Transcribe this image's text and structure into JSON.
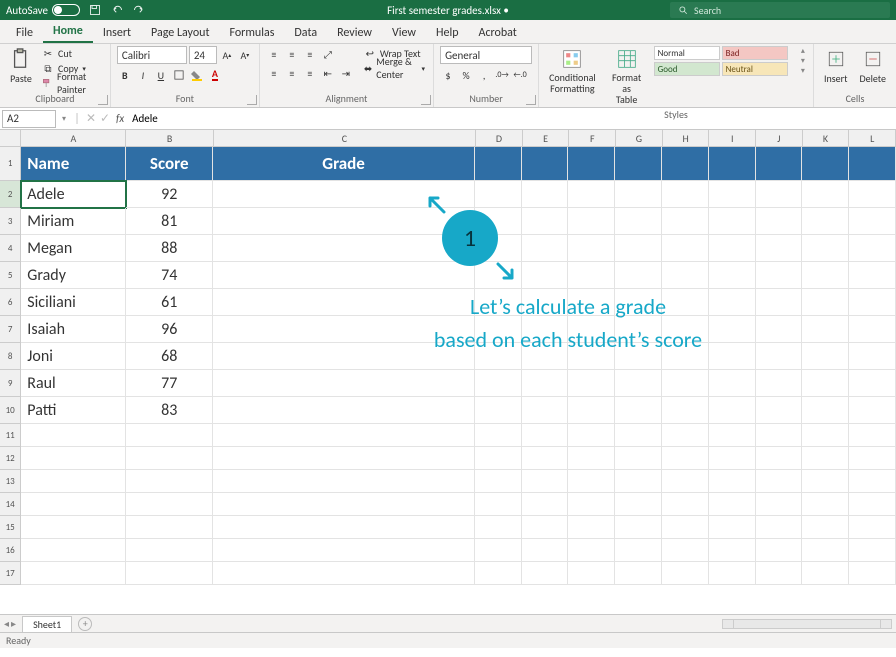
{
  "title": "First semester grades.xlsx •",
  "autosave_label": "AutoSave",
  "autosave_state": "Off",
  "search_placeholder": "Search",
  "menu_tabs": [
    "File",
    "Home",
    "Insert",
    "Page Layout",
    "Formulas",
    "Data",
    "Review",
    "View",
    "Help",
    "Acrobat"
  ],
  "active_menu_tab": "Home",
  "ribbon": {
    "clipboard": {
      "label": "Clipboard",
      "paste": "Paste",
      "cut": "Cut",
      "copy": "Copy",
      "format_painter": "Format Painter"
    },
    "font": {
      "label": "Font",
      "name": "Calibri",
      "size": "24"
    },
    "alignment": {
      "label": "Alignment",
      "wrap": "Wrap Text",
      "merge": "Merge & Center"
    },
    "number": {
      "label": "Number",
      "format": "General"
    },
    "styles": {
      "label": "Styles",
      "conditional": "Conditional\nFormatting",
      "format_table": "Format as\nTable",
      "normal": "Normal",
      "bad": "Bad",
      "good": "Good",
      "neutral": "Neutral"
    },
    "cells": {
      "label": "Cells",
      "insert": "Insert",
      "delete": "Delete"
    }
  },
  "name_box": "A2",
  "formula_value": "Adele",
  "columns": [
    "A",
    "B",
    "C",
    "D",
    "E",
    "F",
    "G",
    "H",
    "I",
    "J",
    "K",
    "L"
  ],
  "chart_data": {
    "type": "table",
    "headers": {
      "name": "Name",
      "score": "Score",
      "grade": "Grade"
    },
    "rows": [
      {
        "name": "Adele",
        "score": 92
      },
      {
        "name": "Miriam",
        "score": 81
      },
      {
        "name": "Megan",
        "score": 88
      },
      {
        "name": "Grady",
        "score": 74
      },
      {
        "name": "Siciliani",
        "score": 61
      },
      {
        "name": "Isaiah",
        "score": 96
      },
      {
        "name": "Joni",
        "score": 68
      },
      {
        "name": "Raul",
        "score": 77
      },
      {
        "name": "Patti",
        "score": 83
      }
    ]
  },
  "annotation": {
    "step": "1",
    "line1": "Let’s calculate a grade",
    "line2": "based on each student’s score"
  },
  "sheet_tab": "Sheet1",
  "status": "Ready"
}
